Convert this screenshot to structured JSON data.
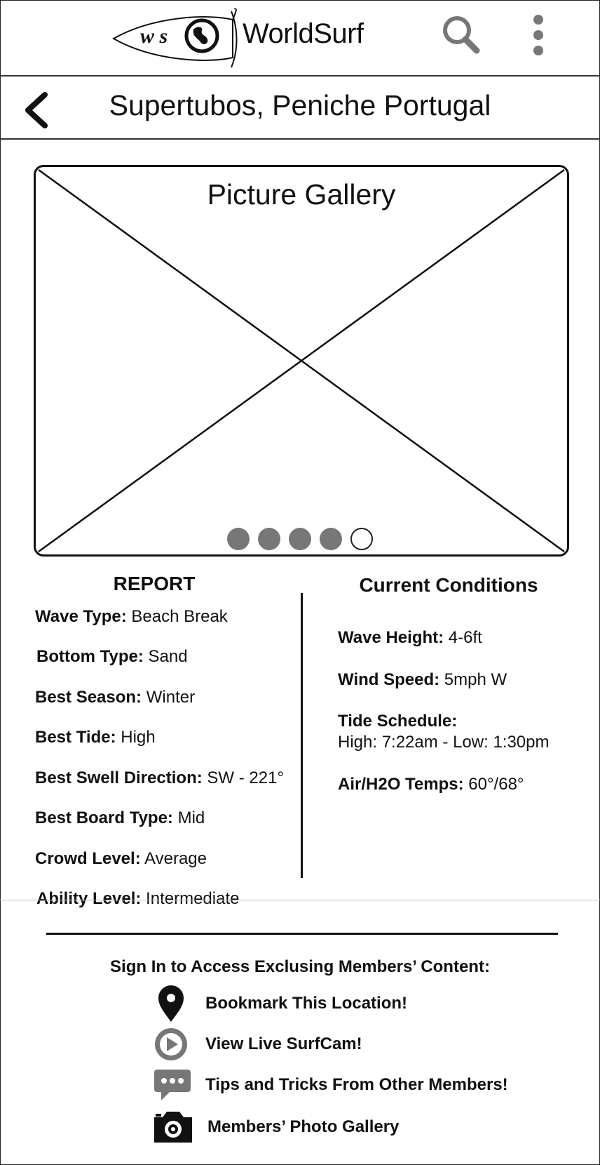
{
  "app": {
    "logo_letters": "w s",
    "brand": "WorldSurf"
  },
  "header": {
    "title": "Supertubos, Peniche Portugal"
  },
  "gallery": {
    "title": "Picture Gallery",
    "pages_total": 5,
    "current_page": 5
  },
  "report": {
    "heading": "REPORT",
    "items": [
      {
        "label": "Wave Type:",
        "value": "Beach Break"
      },
      {
        "label": "Bottom Type:",
        "value": "Sand"
      },
      {
        "label": "Best Season:",
        "value": "Winter"
      },
      {
        "label": "Best Tide:",
        "value": "High"
      },
      {
        "label": "Best Swell Direction:",
        "value": "SW - 221°"
      },
      {
        "label": "Best Board Type:",
        "value": "Mid"
      },
      {
        "label": "Crowd Level:",
        "value": "Average"
      },
      {
        "label": "Ability Level:",
        "value": "Intermediate"
      }
    ]
  },
  "conditions": {
    "heading": "Current Conditions",
    "wave_height": {
      "label": "Wave Height:",
      "value": "4-6ft"
    },
    "wind_speed": {
      "label": "Wind Speed:",
      "value": "5mph W"
    },
    "tide_schedule": {
      "label": "Tide Schedule:",
      "value": "High: 7:22am - Low: 1:30pm"
    },
    "temps": {
      "label": "Air/H2O Temps:",
      "value": "60°/68°"
    }
  },
  "members": {
    "heading": "Sign In to Access Exclusing Members’ Content:",
    "items": [
      {
        "label": "Bookmark This Location!",
        "icon": "map-pin-icon"
      },
      {
        "label": "View Live SurfCam!",
        "icon": "play-icon"
      },
      {
        "label": "Tips and Tricks From Other Members!",
        "icon": "chat-icon"
      },
      {
        "label": "Members’ Photo Gallery",
        "icon": "camera-icon"
      }
    ]
  },
  "colors": {
    "ink": "#111111",
    "gray": "#777777",
    "background": "#ffffff"
  }
}
